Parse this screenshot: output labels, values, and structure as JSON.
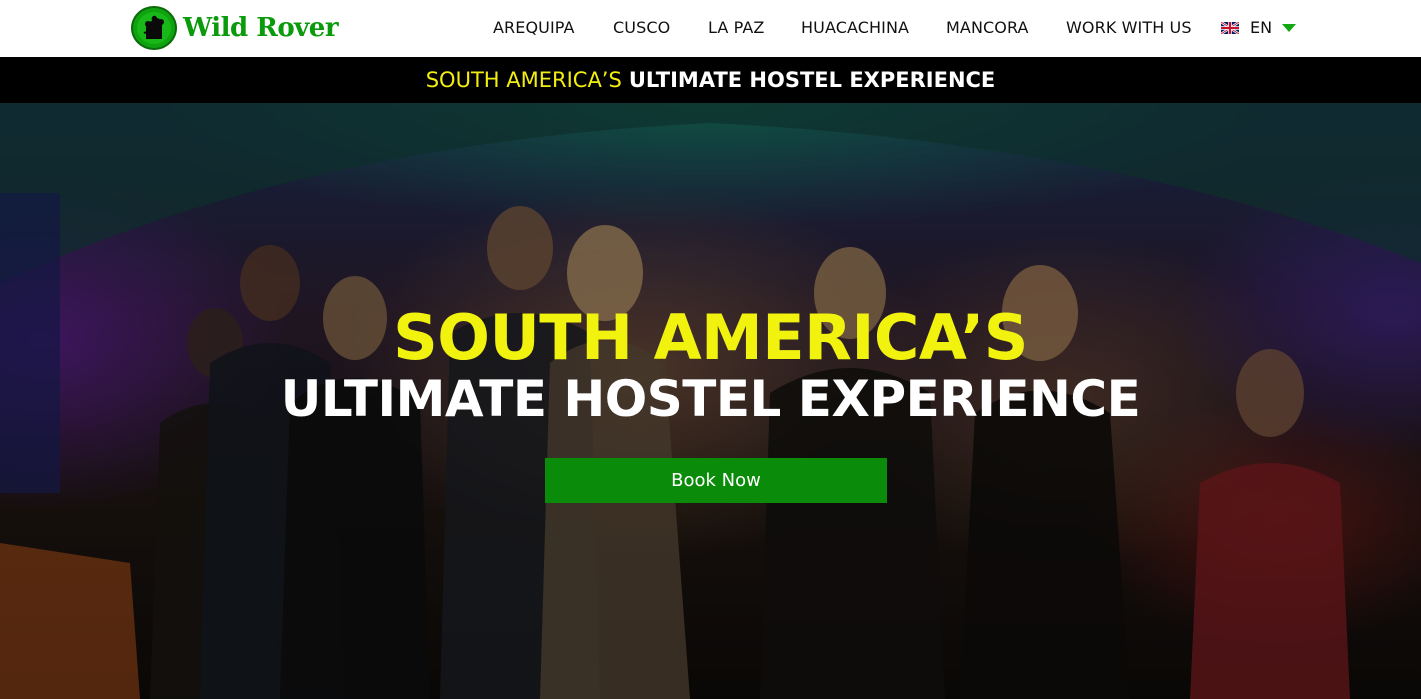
{
  "brand": {
    "name": "Wild Rover",
    "logo_icon": "wild-rover-badge",
    "color": "#0b9a0b"
  },
  "nav": {
    "items": [
      {
        "label": "AREQUIPA"
      },
      {
        "label": "CUSCO"
      },
      {
        "label": "LA PAZ"
      },
      {
        "label": "HUACACHINA"
      },
      {
        "label": "MANCORA"
      },
      {
        "label": "WORK WITH US"
      }
    ],
    "language": {
      "label": "EN",
      "flag_icon": "uk-flag-icon",
      "caret_icon": "chevron-down-icon",
      "caret_color": "#12a812"
    }
  },
  "topbar": {
    "yellow_text": "SOUTH AMERICA’S",
    "bold_text": "ULTIMATE HOSTEL EXPERIENCE",
    "yellow_color": "#f2ee11"
  },
  "hero": {
    "title_line1": "SOUTH AMERICA’S",
    "title_line2": "ULTIMATE HOSTEL EXPERIENCE",
    "cta_label": "Book Now",
    "cta_color": "#0a8c0a",
    "title_color": "#f2f20f"
  }
}
